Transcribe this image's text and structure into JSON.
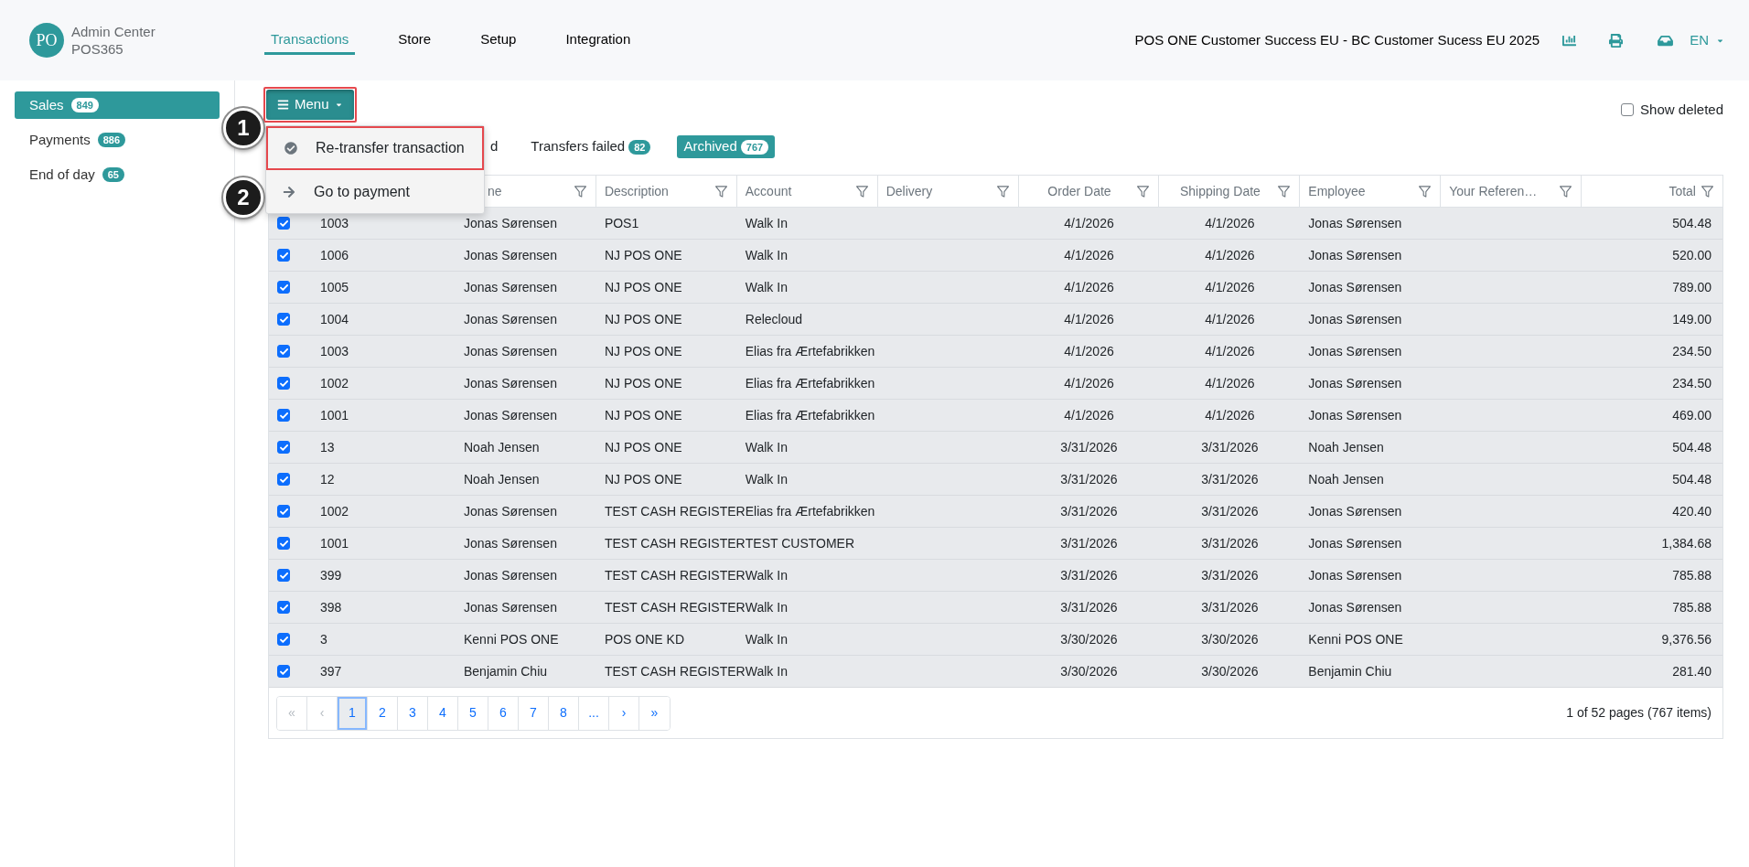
{
  "header": {
    "logo_initials": "PO",
    "app_name": "Admin Center",
    "tenant": "POS365",
    "nav": [
      {
        "label": "Transactions",
        "selected": true
      },
      {
        "label": "Store",
        "selected": false
      },
      {
        "label": "Setup",
        "selected": false
      },
      {
        "label": "Integration",
        "selected": false
      }
    ],
    "company": "POS ONE Customer Success EU - BC Customer Sucess EU 2025",
    "language": "EN"
  },
  "sidebar": {
    "items": [
      {
        "label": "Sales",
        "count": "849",
        "selected": true
      },
      {
        "label": "Payments",
        "count": "886",
        "selected": false
      },
      {
        "label": "End of day",
        "count": "65",
        "selected": false
      }
    ]
  },
  "toolbar": {
    "menu": {
      "label": "Menu",
      "expanded": true,
      "highlighted": true,
      "items": [
        {
          "label": "Re-transfer transaction",
          "kind": "check",
          "step": "1",
          "highlighted": true
        },
        {
          "label": "Go to payment",
          "kind": "arrow",
          "step": "2",
          "highlighted": false
        }
      ]
    },
    "show_deleted": {
      "label": "Show deleted",
      "checked": false
    }
  },
  "tabs": [
    {
      "label": "d",
      "selected": false
    },
    {
      "label": "Transfers failed",
      "count": "82",
      "selected": false
    },
    {
      "label": "Archived",
      "count": "767",
      "selected": true
    }
  ],
  "table": {
    "columns": [
      {
        "kind": "text"
      },
      {
        "label": "ne",
        "kind": "text"
      },
      {
        "label": "Description",
        "kind": "text"
      },
      {
        "label": "Account",
        "kind": "text"
      },
      {
        "label": "Delivery",
        "kind": "text"
      },
      {
        "label": "Order Date",
        "kind": "date"
      },
      {
        "label": "Shipping Date",
        "kind": "date"
      },
      {
        "label": "Employee",
        "kind": "text"
      },
      {
        "label": "Your Referen…",
        "kind": "text"
      },
      {
        "label": "Total",
        "kind": "amount"
      }
    ],
    "rows": [
      {
        "checked": true,
        "cells": [
          "1003",
          "Jonas Sørensen",
          "POS1",
          "Walk In",
          null,
          "4/1/2026",
          "4/1/2026",
          "Jonas Sørensen",
          null,
          "504.48"
        ]
      },
      {
        "checked": true,
        "cells": [
          "1006",
          "Jonas Sørensen",
          "NJ POS ONE",
          "Walk In",
          null,
          "4/1/2026",
          "4/1/2026",
          "Jonas Sørensen",
          null,
          "520.00"
        ]
      },
      {
        "checked": true,
        "cells": [
          "1005",
          "Jonas Sørensen",
          "NJ POS ONE",
          "Walk In",
          null,
          "4/1/2026",
          "4/1/2026",
          "Jonas Sørensen",
          null,
          "789.00"
        ]
      },
      {
        "checked": true,
        "cells": [
          "1004",
          "Jonas Sørensen",
          "NJ POS ONE",
          "Relecloud",
          null,
          "4/1/2026",
          "4/1/2026",
          "Jonas Sørensen",
          null,
          "149.00"
        ]
      },
      {
        "checked": true,
        "cells": [
          "1003",
          "Jonas Sørensen",
          "NJ POS ONE",
          "Elias fra Ærtefabrikken",
          null,
          "4/1/2026",
          "4/1/2026",
          "Jonas Sørensen",
          null,
          "234.50"
        ]
      },
      {
        "checked": true,
        "cells": [
          "1002",
          "Jonas Sørensen",
          "NJ POS ONE",
          "Elias fra Ærtefabrikken",
          null,
          "4/1/2026",
          "4/1/2026",
          "Jonas Sørensen",
          null,
          "234.50"
        ]
      },
      {
        "checked": true,
        "cells": [
          "1001",
          "Jonas Sørensen",
          "NJ POS ONE",
          "Elias fra Ærtefabrikken",
          null,
          "4/1/2026",
          "4/1/2026",
          "Jonas Sørensen",
          null,
          "469.00"
        ]
      },
      {
        "checked": true,
        "cells": [
          "13",
          "Noah Jensen",
          "NJ POS ONE",
          "Walk In",
          null,
          "3/31/2026",
          "3/31/2026",
          "Noah Jensen",
          null,
          "504.48"
        ]
      },
      {
        "checked": true,
        "cells": [
          "12",
          "Noah Jensen",
          "NJ POS ONE",
          "Walk In",
          null,
          "3/31/2026",
          "3/31/2026",
          "Noah Jensen",
          null,
          "504.48"
        ]
      },
      {
        "checked": true,
        "cells": [
          "1002",
          "Jonas Sørensen",
          "TEST CASH REGISTER",
          "Elias fra Ærtefabrikken",
          null,
          "3/31/2026",
          "3/31/2026",
          "Jonas Sørensen",
          null,
          "420.40"
        ]
      },
      {
        "checked": true,
        "cells": [
          "1001",
          "Jonas Sørensen",
          "TEST CASH REGISTER",
          "TEST CUSTOMER",
          null,
          "3/31/2026",
          "3/31/2026",
          "Jonas Sørensen",
          null,
          "1,384.68"
        ]
      },
      {
        "checked": true,
        "cells": [
          "399",
          "Jonas Sørensen",
          "TEST CASH REGISTER",
          "Walk In",
          null,
          "3/31/2026",
          "3/31/2026",
          "Jonas Sørensen",
          null,
          "785.88"
        ]
      },
      {
        "checked": true,
        "cells": [
          "398",
          "Jonas Sørensen",
          "TEST CASH REGISTER",
          "Walk In",
          null,
          "3/31/2026",
          "3/31/2026",
          "Jonas Sørensen",
          null,
          "785.88"
        ]
      },
      {
        "checked": true,
        "cells": [
          "3",
          "Kenni POS ONE",
          "POS ONE KD",
          "Walk In",
          null,
          "3/30/2026",
          "3/30/2026",
          "Kenni POS ONE",
          null,
          "9,376.56"
        ]
      },
      {
        "checked": true,
        "cells": [
          "397",
          "Benjamin Chiu",
          "TEST CASH REGISTER",
          "Walk In",
          null,
          "3/30/2026",
          "3/30/2026",
          "Benjamin Chiu",
          null,
          "281.40"
        ]
      }
    ]
  },
  "pagination": {
    "buttons": [
      {
        "label": "«",
        "selected": false,
        "disabled": true
      },
      {
        "label": "‹",
        "selected": false,
        "disabled": true
      },
      {
        "label": "1",
        "selected": true,
        "disabled": false
      },
      {
        "label": "2",
        "selected": false,
        "disabled": false
      },
      {
        "label": "3",
        "selected": false,
        "disabled": false
      },
      {
        "label": "4",
        "selected": false,
        "disabled": false
      },
      {
        "label": "5",
        "selected": false,
        "disabled": false
      },
      {
        "label": "6",
        "selected": false,
        "disabled": false
      },
      {
        "label": "7",
        "selected": false,
        "disabled": false
      },
      {
        "label": "8",
        "selected": false,
        "disabled": false
      },
      {
        "label": "...",
        "selected": false,
        "disabled": false
      },
      {
        "label": "›",
        "selected": false,
        "disabled": false
      },
      {
        "label": "»",
        "selected": false,
        "disabled": false
      }
    ],
    "summary": "1 of 52 pages (767 items)"
  }
}
